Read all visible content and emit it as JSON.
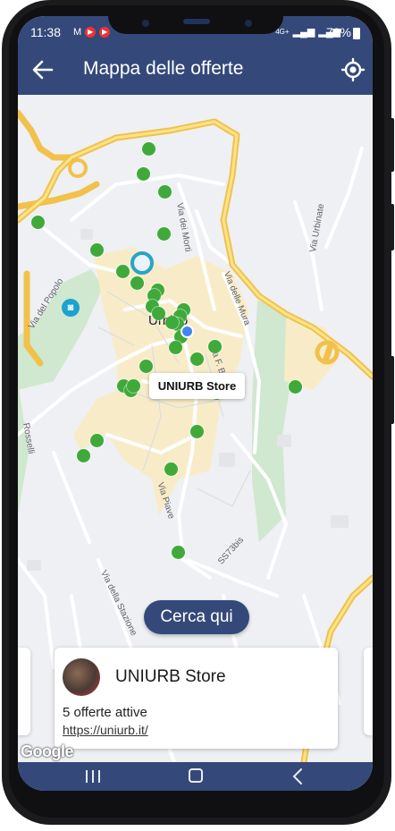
{
  "status_bar": {
    "time": "11:38",
    "network": "4G+",
    "battery": "78%"
  },
  "app_bar": {
    "title": "Mappa delle offerte",
    "back_icon": "arrow-left-icon",
    "locate_icon": "gps-locate-icon"
  },
  "map": {
    "town_label": "Urbino",
    "street_labels": {
      "via_dei_morti": "Via dei Morti",
      "via_urbinate": "Via Urbinate",
      "via_delle_mura": "Via delle Mura",
      "via_del_popolo": "Via del Popolo",
      "via_f_budassi": "Via F. Bud",
      "rosselli": "Rosselli",
      "via_piave": "Via Piave",
      "ss73bis": "SS73bis",
      "via_della_stazione": "Via della Stazione"
    },
    "selected_store_tooltip": "UNIURB Store",
    "search_here_button": "Cerca qui",
    "attribution": "Google"
  },
  "store_card": {
    "name": "UNIURB Store",
    "offers": "5 offerte attive",
    "link": "https://uniurb.it/"
  },
  "colors": {
    "primary": "#34497a",
    "marker": "#3faa3a",
    "road": "#f4c542",
    "park": "#cfe8cf",
    "town": "#f8ecc8"
  }
}
